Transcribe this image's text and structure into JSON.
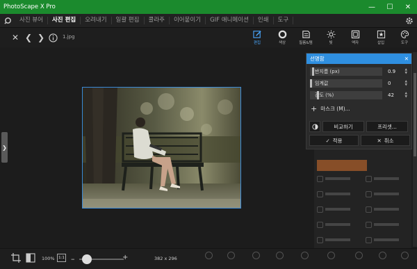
{
  "window": {
    "title": "PhotoScape X Pro"
  },
  "menu": {
    "items": [
      {
        "label": "사진 뷰어",
        "active": false
      },
      {
        "label": "사진 편집",
        "active": true
      },
      {
        "label": "오려내기",
        "active": false
      },
      {
        "label": "일괄 편집",
        "active": false
      },
      {
        "label": "콜라주",
        "active": false
      },
      {
        "label": "이어붙이기",
        "active": false
      },
      {
        "label": "GIF 애니메이션",
        "active": false
      },
      {
        "label": "인쇄",
        "active": false
      },
      {
        "label": "도구",
        "active": false
      }
    ]
  },
  "toolbar": {
    "filename": "1.jpg",
    "tools": [
      {
        "label": "편집",
        "icon": "edit-icon",
        "active": true
      },
      {
        "label": "색상",
        "icon": "circle-icon",
        "active": false
      },
      {
        "label": "필름&템",
        "icon": "film-icon",
        "active": false
      },
      {
        "label": "빛",
        "icon": "sun-icon",
        "active": false
      },
      {
        "label": "액자",
        "icon": "frame-icon",
        "active": false
      },
      {
        "label": "삽입",
        "icon": "star-icon",
        "active": false
      },
      {
        "label": "도구",
        "icon": "palette-icon",
        "active": false
      }
    ]
  },
  "popup": {
    "title": "선명함",
    "sliders": [
      {
        "label": "반지름 (px)",
        "value": "0.9",
        "level": 0.03
      },
      {
        "label": "임계값",
        "value": "0",
        "level": 0.0
      },
      {
        "label": "강도 (%)",
        "value": "42",
        "level": 0.1
      }
    ],
    "mask_label": "마스크 (M)...",
    "compare_label": "비교하기",
    "preset_label": "프리셋...",
    "apply_label": "적용",
    "cancel_label": "취소"
  },
  "bottom": {
    "zoom": "100%",
    "ratio_label": "1:1",
    "dimensions": "382 x 296"
  },
  "colors": {
    "titlebar": "#1b8a2d",
    "accent": "#2f8fe0",
    "background": "#1c1c1c"
  }
}
